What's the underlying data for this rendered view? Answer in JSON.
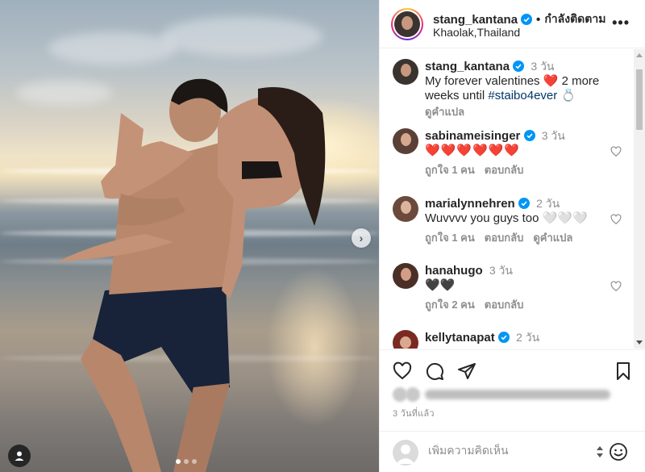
{
  "header": {
    "username": "stang_kantana",
    "separator": "•",
    "follow_status": "กำลังติดตาม",
    "location": "Khaolak,Thailand",
    "more_label": "•••"
  },
  "caption": {
    "username": "stang_kantana",
    "time": "3 วัน",
    "text_before": "My forever valentines ",
    "text_middle": " 2 more weeks until ",
    "hashtag": "#staibo4ever",
    "translate": "ดูคำแปล"
  },
  "comments": [
    {
      "username": "sabinameisinger",
      "time": "3 วัน",
      "text": "",
      "hearts": 6,
      "likes": "ถูกใจ 1 คน",
      "reply": "ตอบกลับ",
      "translate": ""
    },
    {
      "username": "marialynnehren",
      "time": "2 วัน",
      "text": "Wuvvvv you guys too 🤍🤍🤍",
      "hearts": 0,
      "likes": "ถูกใจ 1 คน",
      "reply": "ตอบกลับ",
      "translate": "ดูคำแปล"
    },
    {
      "username": "hanahugo",
      "time": "3 วัน",
      "text": "🖤🖤",
      "hearts": 0,
      "likes": "ถูกใจ 2 คน",
      "reply": "ตอบกลับ",
      "translate": ""
    },
    {
      "username": "kellytanapat",
      "time": "2 วัน",
      "text": "",
      "hearts": 0,
      "likes": "",
      "reply": "",
      "translate": ""
    }
  ],
  "actions": {
    "like": "heart-outline-icon",
    "comment": "comment-bubble-icon",
    "share": "paper-plane-icon",
    "save": "bookmark-icon"
  },
  "posted_ago": "3 วันที่แล้ว",
  "comment_box": {
    "placeholder": "เพิ่มความคิดเห็น"
  },
  "colors": {
    "verified": "#0095f6",
    "heart": "#ed4956",
    "hashtag": "#00376b",
    "muted": "#8e8e8e"
  }
}
